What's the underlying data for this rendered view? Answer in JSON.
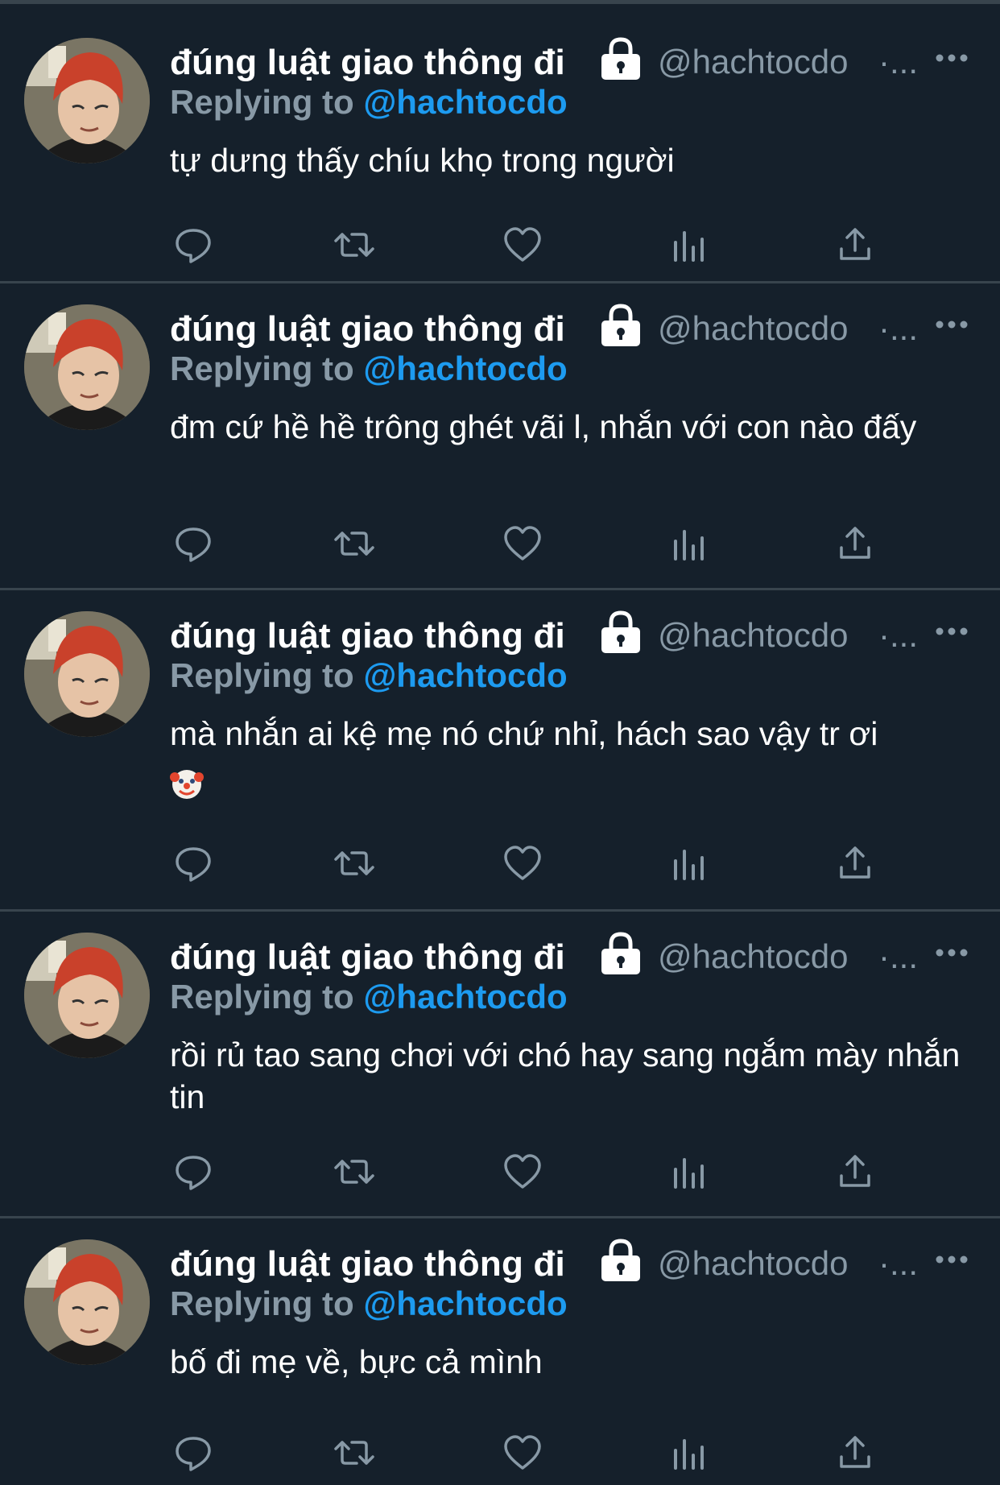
{
  "tweets": [
    {
      "display_name": "đúng luật giao thông đi",
      "handle": "@hachtocdo",
      "dot": "·...",
      "reply_prefix": "Replying to ",
      "reply_handle": "@hachtocdo",
      "text": "tự dưng thấy chíu khọ trong người"
    },
    {
      "display_name": "đúng luật giao thông đi",
      "handle": "@hachtocdo",
      "dot": "·...",
      "reply_prefix": "Replying to ",
      "reply_handle": "@hachtocdo",
      "text": "đm cứ hề hề trông ghét vãi l, nhắn với con nào đấy"
    },
    {
      "display_name": "đúng luật giao thông đi",
      "handle": "@hachtocdo",
      "dot": "·...",
      "reply_prefix": "Replying to ",
      "reply_handle": "@hachtocdo",
      "text": "mà nhắn ai kệ mẹ nó chứ nhỉ, hách sao vậy tr ơi",
      "emoji": "clown-face-icon"
    },
    {
      "display_name": "đúng luật giao thông đi",
      "handle": "@hachtocdo",
      "dot": "·...",
      "reply_prefix": "Replying to ",
      "reply_handle": "@hachtocdo",
      "text": "rồi rủ tao sang chơi với chó hay sang ngắm mày nhắn tin"
    },
    {
      "display_name": "đúng luật giao thông đi",
      "handle": "@hachtocdo",
      "dot": "·...",
      "reply_prefix": "Replying to ",
      "reply_handle": "@hachtocdo",
      "text": "bố đi mẹ về, bực cả mình"
    }
  ],
  "icons": {
    "verified_lock": "lock-icon",
    "more": "more-icon",
    "reply": "reply-icon",
    "retweet": "retweet-icon",
    "like": "heart-icon",
    "views": "views-icon",
    "share": "share-icon"
  },
  "colors": {
    "background": "#15202b",
    "divider": "#38444d",
    "secondary_text": "#8899a6",
    "link": "#1d9bf0",
    "primary_text": "#ffffff"
  }
}
